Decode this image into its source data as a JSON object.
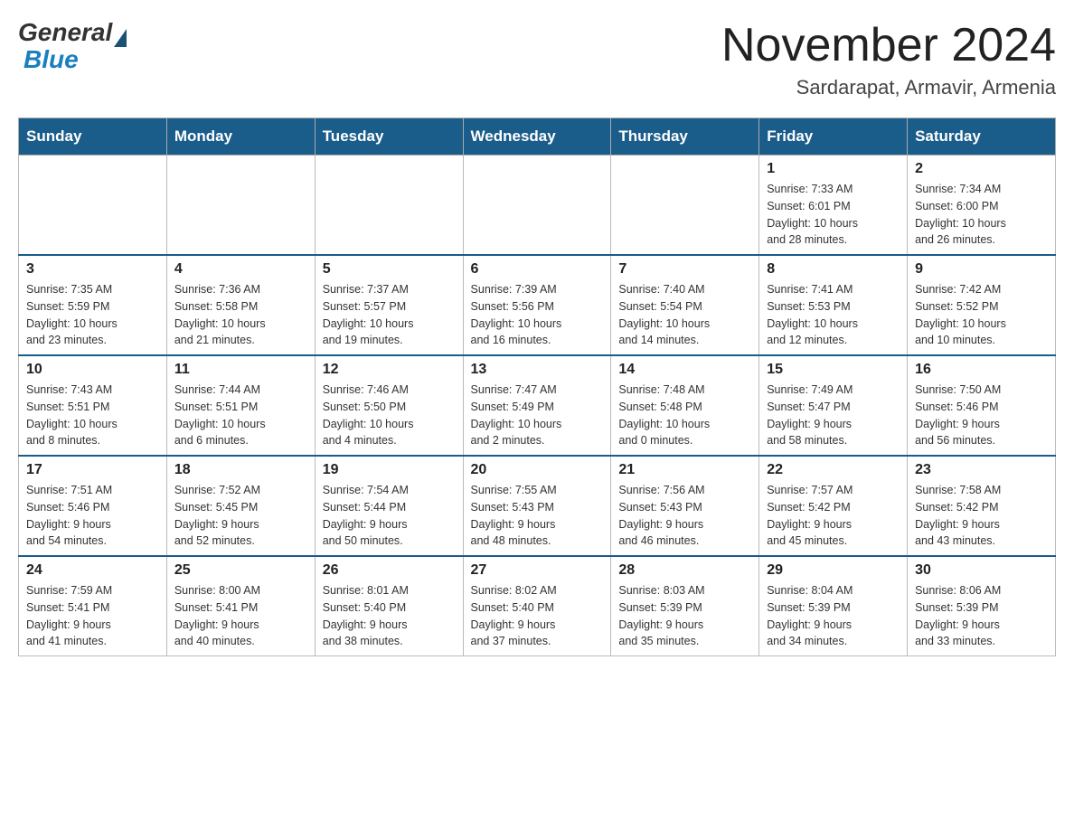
{
  "header": {
    "logo": {
      "general": "General",
      "blue": "Blue"
    },
    "title": "November 2024",
    "location": "Sardarapat, Armavir, Armenia"
  },
  "weekdays": [
    "Sunday",
    "Monday",
    "Tuesday",
    "Wednesday",
    "Thursday",
    "Friday",
    "Saturday"
  ],
  "rows": [
    {
      "cells": [
        {
          "day": "",
          "info": ""
        },
        {
          "day": "",
          "info": ""
        },
        {
          "day": "",
          "info": ""
        },
        {
          "day": "",
          "info": ""
        },
        {
          "day": "",
          "info": ""
        },
        {
          "day": "1",
          "info": "Sunrise: 7:33 AM\nSunset: 6:01 PM\nDaylight: 10 hours\nand 28 minutes."
        },
        {
          "day": "2",
          "info": "Sunrise: 7:34 AM\nSunset: 6:00 PM\nDaylight: 10 hours\nand 26 minutes."
        }
      ]
    },
    {
      "cells": [
        {
          "day": "3",
          "info": "Sunrise: 7:35 AM\nSunset: 5:59 PM\nDaylight: 10 hours\nand 23 minutes."
        },
        {
          "day": "4",
          "info": "Sunrise: 7:36 AM\nSunset: 5:58 PM\nDaylight: 10 hours\nand 21 minutes."
        },
        {
          "day": "5",
          "info": "Sunrise: 7:37 AM\nSunset: 5:57 PM\nDaylight: 10 hours\nand 19 minutes."
        },
        {
          "day": "6",
          "info": "Sunrise: 7:39 AM\nSunset: 5:56 PM\nDaylight: 10 hours\nand 16 minutes."
        },
        {
          "day": "7",
          "info": "Sunrise: 7:40 AM\nSunset: 5:54 PM\nDaylight: 10 hours\nand 14 minutes."
        },
        {
          "day": "8",
          "info": "Sunrise: 7:41 AM\nSunset: 5:53 PM\nDaylight: 10 hours\nand 12 minutes."
        },
        {
          "day": "9",
          "info": "Sunrise: 7:42 AM\nSunset: 5:52 PM\nDaylight: 10 hours\nand 10 minutes."
        }
      ]
    },
    {
      "cells": [
        {
          "day": "10",
          "info": "Sunrise: 7:43 AM\nSunset: 5:51 PM\nDaylight: 10 hours\nand 8 minutes."
        },
        {
          "day": "11",
          "info": "Sunrise: 7:44 AM\nSunset: 5:51 PM\nDaylight: 10 hours\nand 6 minutes."
        },
        {
          "day": "12",
          "info": "Sunrise: 7:46 AM\nSunset: 5:50 PM\nDaylight: 10 hours\nand 4 minutes."
        },
        {
          "day": "13",
          "info": "Sunrise: 7:47 AM\nSunset: 5:49 PM\nDaylight: 10 hours\nand 2 minutes."
        },
        {
          "day": "14",
          "info": "Sunrise: 7:48 AM\nSunset: 5:48 PM\nDaylight: 10 hours\nand 0 minutes."
        },
        {
          "day": "15",
          "info": "Sunrise: 7:49 AM\nSunset: 5:47 PM\nDaylight: 9 hours\nand 58 minutes."
        },
        {
          "day": "16",
          "info": "Sunrise: 7:50 AM\nSunset: 5:46 PM\nDaylight: 9 hours\nand 56 minutes."
        }
      ]
    },
    {
      "cells": [
        {
          "day": "17",
          "info": "Sunrise: 7:51 AM\nSunset: 5:46 PM\nDaylight: 9 hours\nand 54 minutes."
        },
        {
          "day": "18",
          "info": "Sunrise: 7:52 AM\nSunset: 5:45 PM\nDaylight: 9 hours\nand 52 minutes."
        },
        {
          "day": "19",
          "info": "Sunrise: 7:54 AM\nSunset: 5:44 PM\nDaylight: 9 hours\nand 50 minutes."
        },
        {
          "day": "20",
          "info": "Sunrise: 7:55 AM\nSunset: 5:43 PM\nDaylight: 9 hours\nand 48 minutes."
        },
        {
          "day": "21",
          "info": "Sunrise: 7:56 AM\nSunset: 5:43 PM\nDaylight: 9 hours\nand 46 minutes."
        },
        {
          "day": "22",
          "info": "Sunrise: 7:57 AM\nSunset: 5:42 PM\nDaylight: 9 hours\nand 45 minutes."
        },
        {
          "day": "23",
          "info": "Sunrise: 7:58 AM\nSunset: 5:42 PM\nDaylight: 9 hours\nand 43 minutes."
        }
      ]
    },
    {
      "cells": [
        {
          "day": "24",
          "info": "Sunrise: 7:59 AM\nSunset: 5:41 PM\nDaylight: 9 hours\nand 41 minutes."
        },
        {
          "day": "25",
          "info": "Sunrise: 8:00 AM\nSunset: 5:41 PM\nDaylight: 9 hours\nand 40 minutes."
        },
        {
          "day": "26",
          "info": "Sunrise: 8:01 AM\nSunset: 5:40 PM\nDaylight: 9 hours\nand 38 minutes."
        },
        {
          "day": "27",
          "info": "Sunrise: 8:02 AM\nSunset: 5:40 PM\nDaylight: 9 hours\nand 37 minutes."
        },
        {
          "day": "28",
          "info": "Sunrise: 8:03 AM\nSunset: 5:39 PM\nDaylight: 9 hours\nand 35 minutes."
        },
        {
          "day": "29",
          "info": "Sunrise: 8:04 AM\nSunset: 5:39 PM\nDaylight: 9 hours\nand 34 minutes."
        },
        {
          "day": "30",
          "info": "Sunrise: 8:06 AM\nSunset: 5:39 PM\nDaylight: 9 hours\nand 33 minutes."
        }
      ]
    }
  ]
}
